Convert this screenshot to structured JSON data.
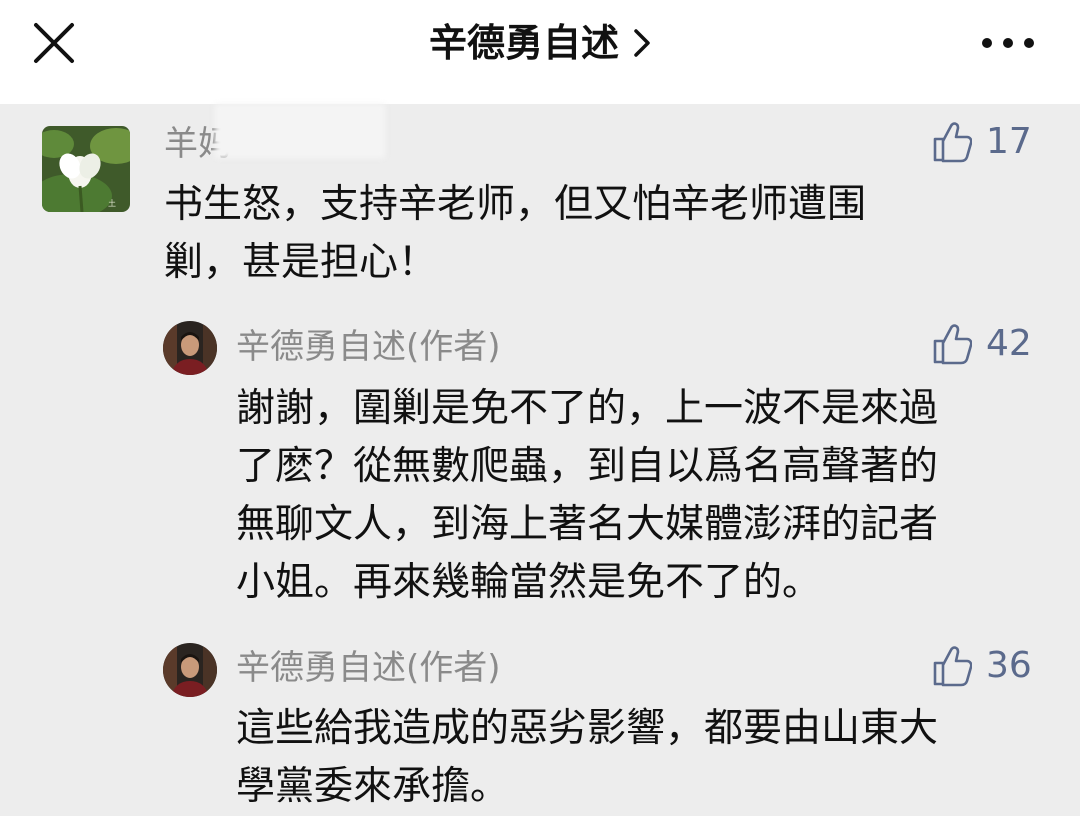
{
  "header": {
    "title": "辛德勇自述"
  },
  "comments": [
    {
      "author": "羊妈",
      "likes": "17",
      "text": "书生怒，支持辛老师，但又怕辛老师遭围\n剿，甚是担心！"
    },
    {
      "author": "辛德勇自述(作者)",
      "likes": "42",
      "text": "謝謝，圍剿是免不了的，上一波不是來過\n了麽？從無數爬蟲，到自以爲名高聲著的\n無聊文人，到海上著名大媒體澎湃的記者\n小姐。再來幾輪當然是免不了的。"
    },
    {
      "author": "辛德勇自述(作者)",
      "likes": "36",
      "text": "這些給我造成的惡劣影響，都要由山東大\n學黨委來承擔。"
    }
  ]
}
